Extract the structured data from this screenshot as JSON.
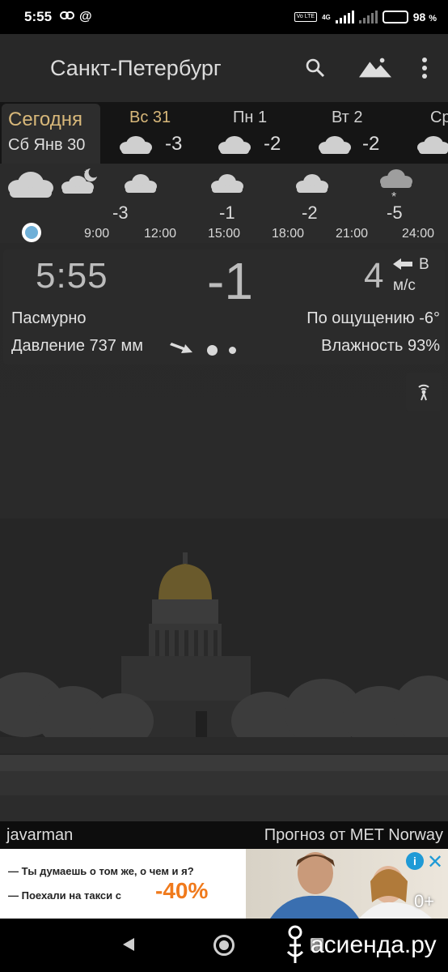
{
  "status_bar": {
    "time": "5:55",
    "left_icons": [
      "link-icon",
      "at-icon"
    ],
    "network": "4G",
    "volte": "Vo LTE",
    "battery_percent": "98",
    "battery_suffix": "%"
  },
  "app_bar": {
    "title": "Санкт-Петербург",
    "actions": [
      "search-icon",
      "landscape-icon",
      "more-vertical-icon"
    ]
  },
  "days": {
    "active": {
      "label": "Сегодня",
      "date": "Сб Янв 30"
    },
    "items": [
      {
        "name": "Вс 31",
        "temp": "-3",
        "highlight": true
      },
      {
        "name": "Пн 1",
        "temp": "-2",
        "highlight": false
      },
      {
        "name": "Вт 2",
        "temp": "-2",
        "highlight": false
      },
      {
        "name": "Ср",
        "temp": "",
        "highlight": false
      }
    ]
  },
  "hourly": {
    "temps": [
      "-3",
      "-1",
      "-2",
      "-5"
    ],
    "times": [
      "9:00",
      "12:00",
      "15:00",
      "18:00",
      "21:00",
      "24:00"
    ],
    "icons": [
      "cloud-icon",
      "cloud-moon-icon",
      "cloud-icon",
      "cloud-icon",
      "cloud-icon",
      "cloud-snow-icon"
    ]
  },
  "current": {
    "time": "5:55",
    "temperature": "-1",
    "wind_speed": "4",
    "wind_direction": "В",
    "wind_unit": "м/с",
    "condition": "Пасмурно",
    "feels_like": "По ощущению -6°",
    "pressure": "Давление 737 мм",
    "humidity": "Влажность 93%"
  },
  "credits": {
    "user": "javarman",
    "source": "Прогноз от MET Norway"
  },
  "ad": {
    "line1": "— Ты думаешь о том же, о чем и я?",
    "line2": "— Поехали на такси с",
    "discount": "-40%",
    "age_rating": "0+",
    "info_label": "i",
    "close_label": "✕"
  },
  "watermark": "асиенда.ру",
  "colors": {
    "accent_gold": "#d8b87a",
    "now_dot": "#6fb0d8",
    "ad_orange": "#f07a1c",
    "ad_blue": "#1f9ad6"
  }
}
